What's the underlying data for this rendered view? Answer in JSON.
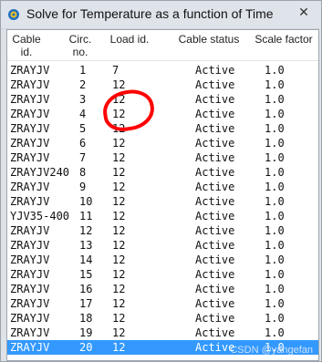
{
  "window": {
    "title": "Solve for Temperature as a function of Time",
    "close_glyph": "✕"
  },
  "table": {
    "columns": [
      "Cable id.",
      "Circ. no.",
      "Load id.",
      "Cable status",
      "Scale factor"
    ],
    "rows": [
      {
        "cable": "ZRAYJV",
        "circ": "1",
        "load": "7",
        "status": "Active",
        "scale": "1.0"
      },
      {
        "cable": "ZRAYJV",
        "circ": "2",
        "load": "12",
        "status": "Active",
        "scale": "1.0"
      },
      {
        "cable": "ZRAYJV",
        "circ": "3",
        "load": "12",
        "status": "Active",
        "scale": "1.0"
      },
      {
        "cable": "ZRAYJV",
        "circ": "4",
        "load": "12",
        "status": "Active",
        "scale": "1.0"
      },
      {
        "cable": "ZRAYJV",
        "circ": "5",
        "load": "12",
        "status": "Active",
        "scale": "1.0"
      },
      {
        "cable": "ZRAYJV",
        "circ": "6",
        "load": "12",
        "status": "Active",
        "scale": "1.0"
      },
      {
        "cable": "ZRAYJV",
        "circ": "7",
        "load": "12",
        "status": "Active",
        "scale": "1.0"
      },
      {
        "cable": "ZRAYJV240",
        "circ": "8",
        "load": "12",
        "status": "Active",
        "scale": "1.0"
      },
      {
        "cable": "ZRAYJV",
        "circ": "9",
        "load": "12",
        "status": "Active",
        "scale": "1.0"
      },
      {
        "cable": "ZRAYJV",
        "circ": "10",
        "load": "12",
        "status": "Active",
        "scale": "1.0"
      },
      {
        "cable": "YJV35-400",
        "circ": "11",
        "load": "12",
        "status": "Active",
        "scale": "1.0"
      },
      {
        "cable": "ZRAYJV",
        "circ": "12",
        "load": "12",
        "status": "Active",
        "scale": "1.0"
      },
      {
        "cable": "ZRAYJV",
        "circ": "13",
        "load": "12",
        "status": "Active",
        "scale": "1.0"
      },
      {
        "cable": "ZRAYJV",
        "circ": "14",
        "load": "12",
        "status": "Active",
        "scale": "1.0"
      },
      {
        "cable": "ZRAYJV",
        "circ": "15",
        "load": "12",
        "status": "Active",
        "scale": "1.0"
      },
      {
        "cable": "ZRAYJV",
        "circ": "16",
        "load": "12",
        "status": "Active",
        "scale": "1.0"
      },
      {
        "cable": "ZRAYJV",
        "circ": "17",
        "load": "12",
        "status": "Active",
        "scale": "1.0"
      },
      {
        "cable": "ZRAYJV",
        "circ": "18",
        "load": "12",
        "status": "Active",
        "scale": "1.0"
      },
      {
        "cable": "ZRAYJV",
        "circ": "19",
        "load": "12",
        "status": "Active",
        "scale": "1.0"
      },
      {
        "cable": "ZRAYJV",
        "circ": "20",
        "load": "12",
        "status": "Active",
        "scale": "1.0",
        "selected": true
      }
    ]
  },
  "watermark": "CSDN @yangefan",
  "colors": {
    "selected_row": "#3399ff",
    "annotation": "#ff0000"
  }
}
